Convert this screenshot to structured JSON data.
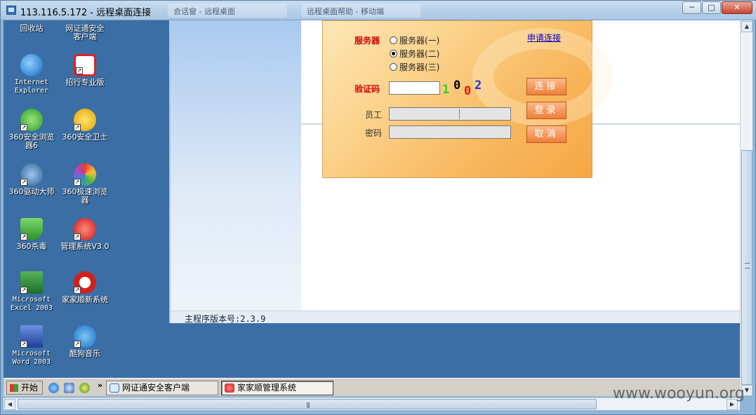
{
  "window": {
    "title": "113.116.5.172 - 远程桌面连接",
    "minimize": "─",
    "maximize": "□",
    "close": "✕",
    "ghost_tabs": [
      "会话窗 - 远程桌面",
      "远程桌面帮助 - 移动端"
    ]
  },
  "desktop_icons": [
    {
      "label": "回收站"
    },
    {
      "label": "网证通安全客户端"
    },
    {
      "label": "Internet Explorer"
    },
    {
      "label": "招行专业版"
    },
    {
      "label": "360安全浏览器6"
    },
    {
      "label": "360安全卫士"
    },
    {
      "label": "360驱动大师"
    },
    {
      "label": "360极速浏览器"
    },
    {
      "label": "360杀毒"
    },
    {
      "label": "管理系统V3.0"
    },
    {
      "label": "Microsoft Excel 2003"
    },
    {
      "label": "家家顺新系统"
    },
    {
      "label": "Microsoft Word 2003"
    },
    {
      "label": "酷狗音乐"
    }
  ],
  "login": {
    "server_label": "服务器",
    "servers": [
      "服务器(一)",
      "服务器(二)",
      "服务器(三)"
    ],
    "selected_server": "服务器(二)",
    "apply_link": "申请连接",
    "captcha_label": "验证码",
    "captcha_value": "",
    "captcha_digits": [
      "1",
      "0",
      "0",
      "2"
    ],
    "employee_label": "员工",
    "password_label": "密码",
    "connect_button": "连接",
    "login_button": "登录",
    "cancel_button": "取消"
  },
  "status": {
    "version_text": "主程序版本号:2.3.9"
  },
  "taskbar": {
    "start_label": "开始",
    "more_label": "»",
    "tasks": [
      {
        "label": "网证通安全客户端"
      },
      {
        "label": "家家顺管理系统"
      }
    ]
  },
  "watermark": "www.wooyun.org",
  "colors": {
    "desktop_bg": "#3a6ea5",
    "label_red": "#d40000",
    "button_orange": "#ef7e3b",
    "link_blue": "#0000cc"
  }
}
